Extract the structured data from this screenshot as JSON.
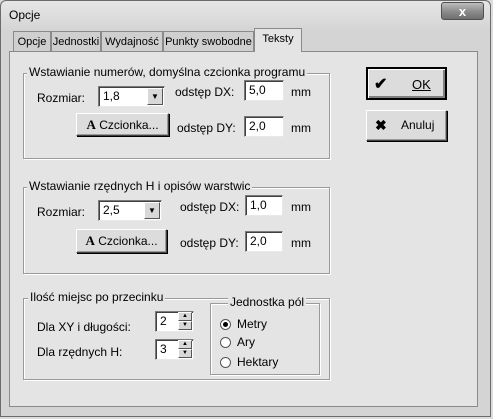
{
  "window": {
    "title": "Opcje",
    "close_glyph": "x"
  },
  "tabs": [
    {
      "label": "Opcje",
      "active": false
    },
    {
      "label": "Jednostki",
      "active": false
    },
    {
      "label": "Wydajność",
      "active": false
    },
    {
      "label": "Punkty swobodne",
      "active": false
    },
    {
      "label": "Teksty",
      "active": true
    }
  ],
  "group_numbers": {
    "legend": "Wstawianie numerów, domyślna czcionka programu",
    "size_label": "Rozmiar:",
    "size_value": "1,8",
    "dx_label": "odstęp DX:",
    "dx_value": "5,0",
    "dx_unit": "mm",
    "dy_label": "odstęp DY:",
    "dy_value": "2,0",
    "dy_unit": "mm",
    "font_button": "Czcionka...",
    "font_button_glyph": "A"
  },
  "group_ordinates": {
    "legend": "Wstawianie rzędnych H i opisów warstwic",
    "size_label": "Rozmiar:",
    "size_value": "2,5",
    "dx_label": "odstęp DX:",
    "dx_value": "1,0",
    "dx_unit": "mm",
    "dy_label": "odstęp DY:",
    "dy_value": "2,0",
    "dy_unit": "mm",
    "font_button": "Czcionka...",
    "font_button_glyph": "A"
  },
  "group_decimals": {
    "legend": "Ilość miejsc po przecinku",
    "xy_label": "Dla XY i długości:",
    "xy_value": "2",
    "h_label": "Dla rzędnych H:",
    "h_value": "3"
  },
  "group_area_unit": {
    "legend": "Jednostka pól",
    "options": [
      {
        "label": "Metry",
        "checked": true
      },
      {
        "label": "Ary",
        "checked": false
      },
      {
        "label": "Hektary",
        "checked": false
      }
    ]
  },
  "buttons": {
    "ok_label": "OK",
    "ok_glyph": "✔",
    "cancel_label": "Anuluj",
    "cancel_glyph": "✖"
  }
}
